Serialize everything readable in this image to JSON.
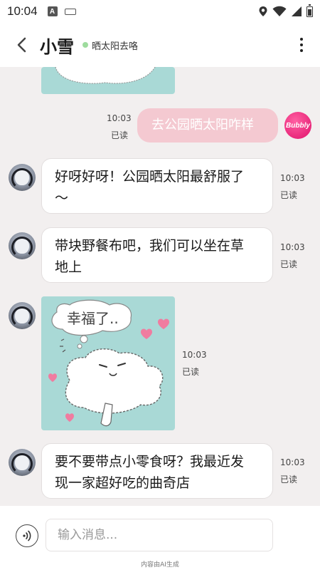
{
  "status_bar": {
    "time": "10:04",
    "a_icon_letter": "A"
  },
  "header": {
    "contact_name": "小雪",
    "contact_status": "晒太阳去咯",
    "status_dot_color": "#9edc9e"
  },
  "messages": [
    {
      "side": "left",
      "type": "image",
      "partial": true
    },
    {
      "side": "right",
      "type": "text",
      "text": "去公园晒太阳咋样",
      "time": "10:03",
      "read": "已读",
      "avatar_label": "Bubbly"
    },
    {
      "side": "left",
      "type": "text",
      "lines": [
        "好呀好呀！公园晒太阳最舒服了",
        "～"
      ],
      "time": "10:03",
      "read": "已读"
    },
    {
      "side": "left",
      "type": "text",
      "lines": [
        "带块野餐布吧，我们可以坐在草",
        "地上"
      ],
      "time": "10:03",
      "read": "已读"
    },
    {
      "side": "left",
      "type": "image",
      "image_caption": "幸福了..",
      "time": "10:03",
      "read": "已读"
    },
    {
      "side": "left",
      "type": "text",
      "lines": [
        "要不要带点小零食呀？我最近发",
        "现一家超好吃的曲奇店"
      ],
      "time": "10:03",
      "read": "已读"
    }
  ],
  "input": {
    "placeholder": "输入消息..."
  },
  "footer": {
    "ai_note": "内容由AI生成"
  },
  "colors": {
    "background": "#f2efef",
    "right_bubble": "#f4c9d1",
    "image_bg": "#a9d9d6",
    "bubbly_avatar": "#e0126b"
  }
}
